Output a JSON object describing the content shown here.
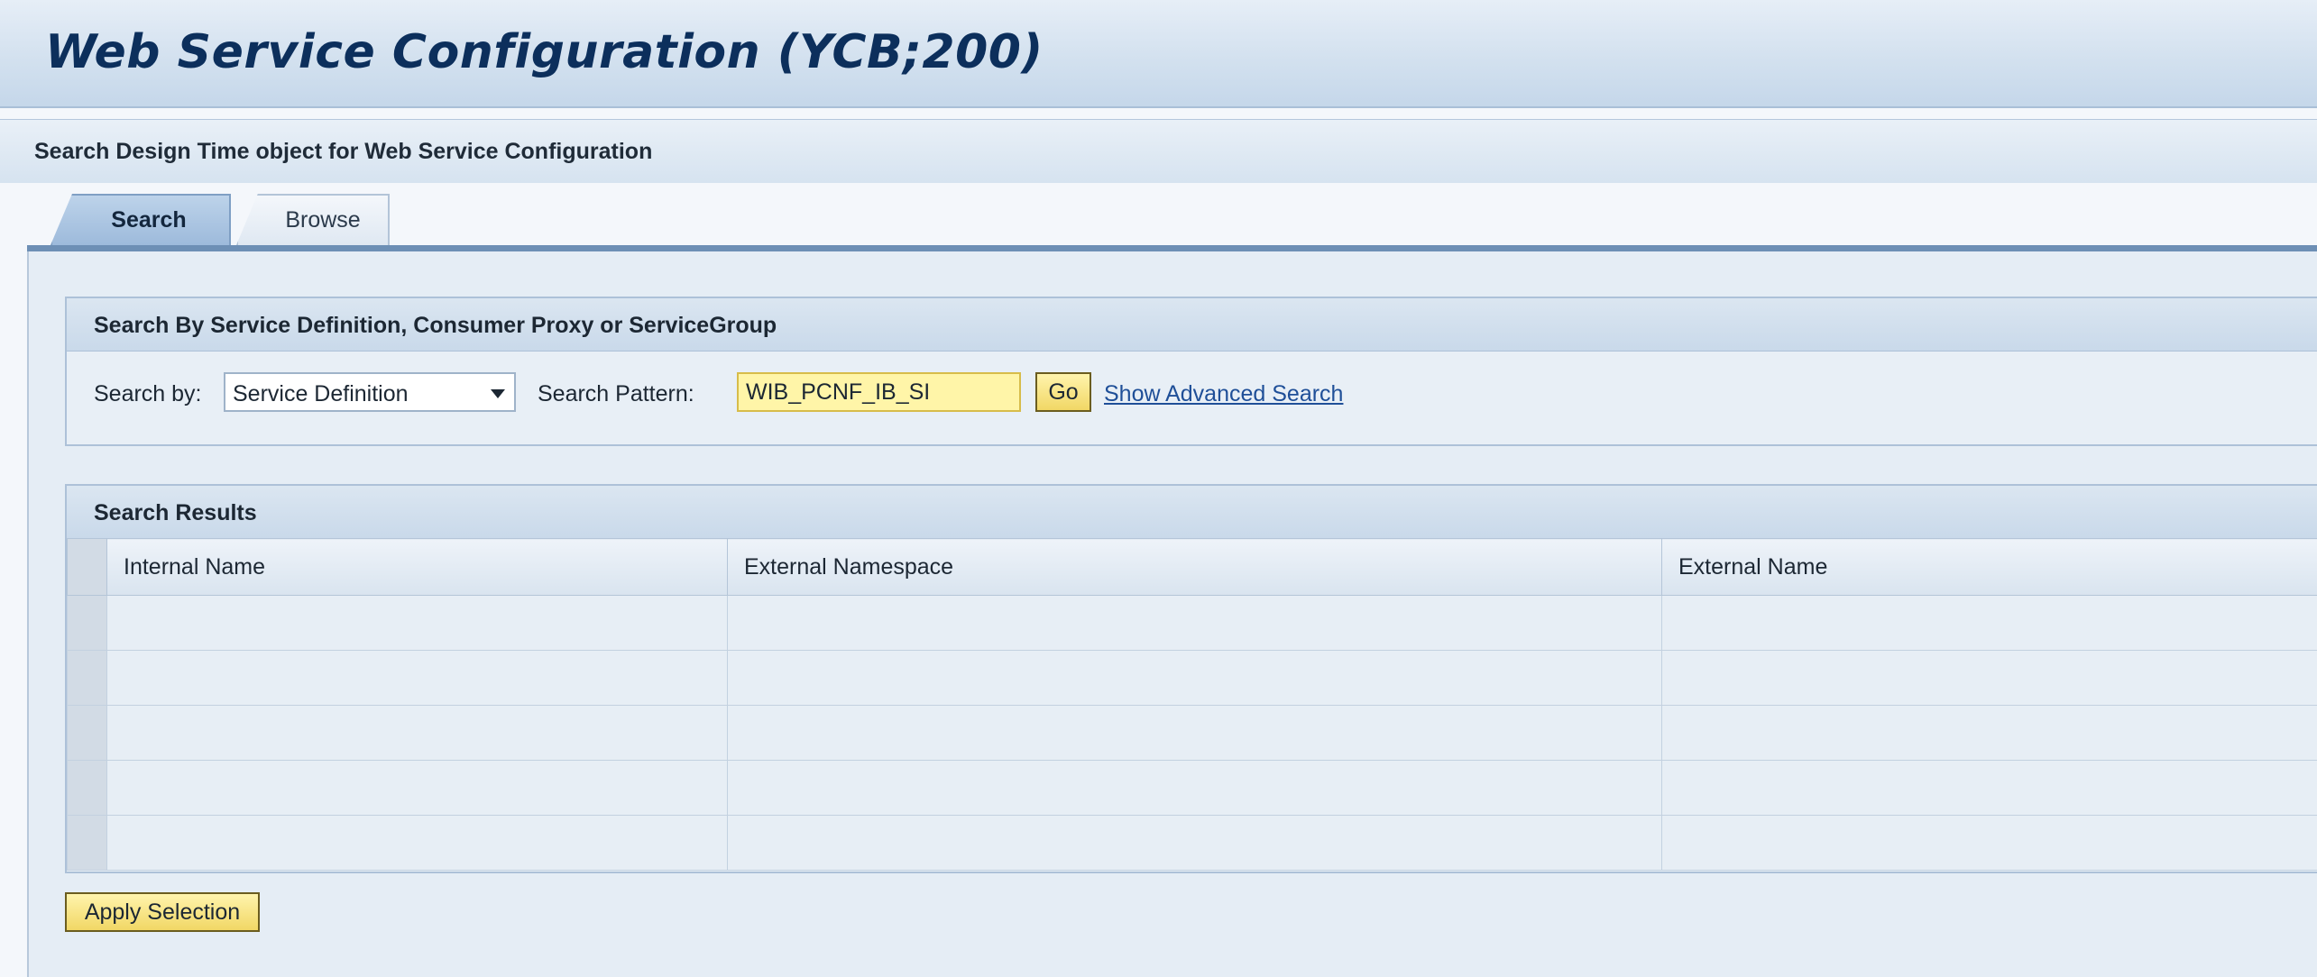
{
  "window": {
    "title": "Web Service Configuration (YCB;200)"
  },
  "subtitle": "Search Design Time object for Web Service Configuration",
  "tabs": [
    {
      "label": "Search",
      "active": true
    },
    {
      "label": "Browse",
      "active": false
    }
  ],
  "search_panel": {
    "header": "Search By Service Definition, Consumer Proxy or ServiceGroup",
    "search_by_label": "Search by:",
    "search_by_value": "Service Definition",
    "search_pattern_label": "Search Pattern:",
    "search_pattern_value": "WIB_PCNF_IB_SI",
    "go_label": "Go",
    "advanced_link": "Show Advanced Search"
  },
  "results_panel": {
    "header": "Search Results",
    "columns": [
      "Internal Name",
      "External Namespace",
      "External Name"
    ],
    "rows": [
      [
        "",
        "",
        ""
      ],
      [
        "",
        "",
        ""
      ],
      [
        "",
        "",
        ""
      ],
      [
        "",
        "",
        ""
      ],
      [
        "",
        "",
        ""
      ]
    ]
  },
  "apply_label": "Apply Selection",
  "colors": {
    "title_text": "#0c2f5c",
    "highlight_input": "#fff5a8",
    "button_fill": "#f1d765",
    "link": "#1f4f98",
    "tab_active": "#9dbadb"
  }
}
